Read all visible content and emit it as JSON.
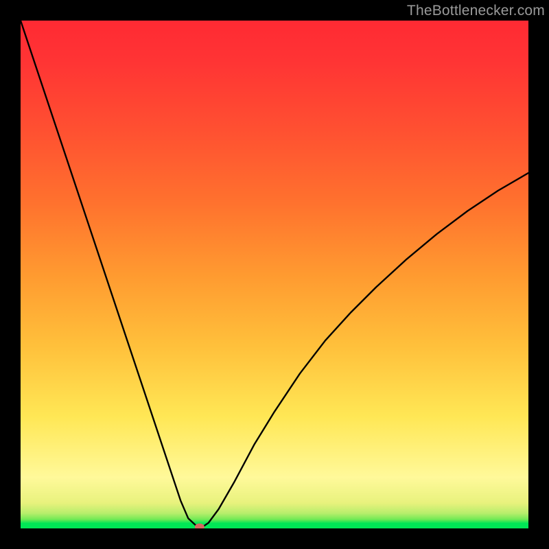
{
  "watermark": {
    "text": "TheBottlenecker.com"
  },
  "chart_data": {
    "type": "line",
    "title": "",
    "xlabel": "",
    "ylabel": "",
    "xlim": [
      0,
      100
    ],
    "ylim": [
      0,
      100
    ],
    "gradient_colors": {
      "top": "#ff2a33",
      "mid": "#fff99a",
      "bottom": "#00e756"
    },
    "series": [
      {
        "name": "bottleneck-curve",
        "x": [
          0,
          3,
          6,
          9,
          12,
          15,
          18,
          21,
          24,
          27,
          30,
          31.5,
          33,
          34.5,
          35.25,
          36,
          37,
          39,
          42,
          46,
          50,
          55,
          60,
          65,
          70,
          76,
          82,
          88,
          94,
          100
        ],
        "y": [
          100,
          91,
          82,
          73,
          64,
          55,
          46,
          37,
          28,
          19,
          10,
          5.5,
          2.0,
          0.6,
          0.3,
          0.4,
          1.1,
          3.8,
          9.0,
          16.5,
          23.0,
          30.5,
          37.0,
          42.5,
          47.5,
          53.0,
          58.0,
          62.5,
          66.5,
          70.0
        ]
      }
    ],
    "marker": {
      "name": "optimal-point",
      "x": 35.25,
      "y": 0.3,
      "color": "#d46a5f"
    }
  }
}
